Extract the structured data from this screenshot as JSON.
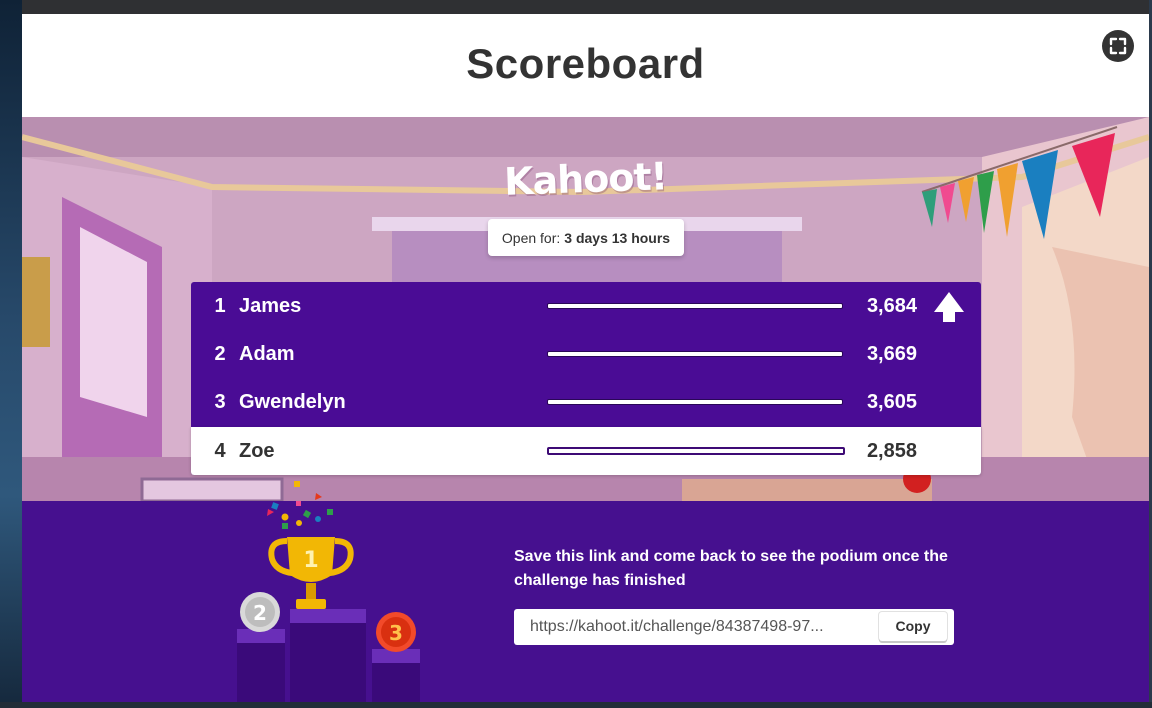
{
  "header": {
    "title": "Scoreboard"
  },
  "banner": {
    "logo_text": "Kahoot!",
    "open_label": "Open for:",
    "open_value": "3 days 13 hours"
  },
  "leaderboard": [
    {
      "rank": "1",
      "name": "James",
      "score": "3,684"
    },
    {
      "rank": "2",
      "name": "Adam",
      "score": "3,669"
    },
    {
      "rank": "3",
      "name": "Gwendelyn",
      "score": "3,605"
    },
    {
      "rank": "4",
      "name": "Zoe",
      "score": "2,858"
    }
  ],
  "podium": {
    "first": "1",
    "second": "2",
    "third": "3"
  },
  "save": {
    "message": "Save this link and come back to see the podium once the challenge has finished",
    "link": "https://kahoot.it/challenge/84387498-97...",
    "copy_label": "Copy"
  },
  "colors": {
    "board": "#4a0c95",
    "bottom": "#46108f",
    "title_text": "#333333",
    "gold": "#f2b705",
    "silver": "#c9c9c9",
    "bronze": "#e5391d"
  },
  "icons": {
    "fullscreen": "fullscreen-icon",
    "rank_up": "arrow-up-icon"
  }
}
